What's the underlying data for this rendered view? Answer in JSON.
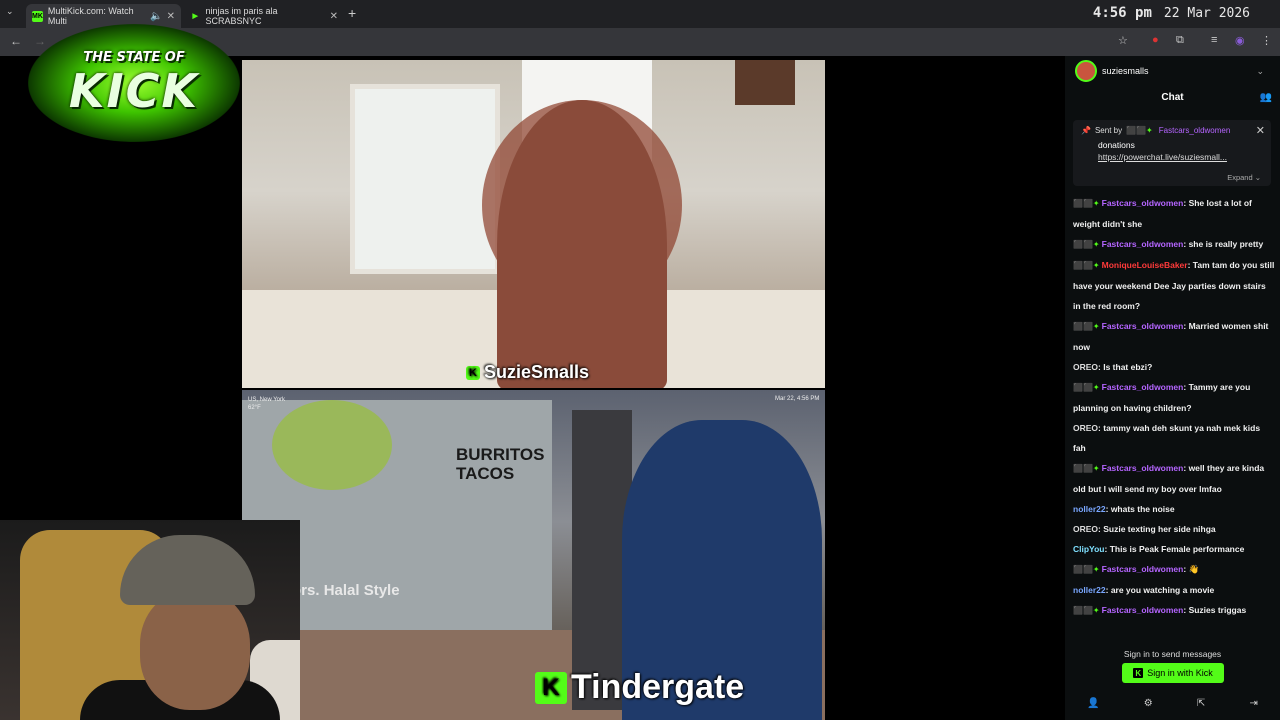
{
  "browser": {
    "tabs": [
      {
        "label": "MultiKick.com: Watch Multi",
        "favicon": "MK",
        "active": true
      },
      {
        "label": "ninjas im paris ala SCRABSNYC",
        "favicon": "play-icon",
        "active": false
      }
    ],
    "clock": {
      "time": "4:56 pm",
      "date": "22 Mar 2026"
    }
  },
  "overlay": {
    "logo_line1": "THE STATE OF",
    "logo_line2": "KICK"
  },
  "streams": {
    "top": {
      "streamer": "SuzieSmalls"
    },
    "bottom": {
      "streamer": "Tindergate",
      "location_line1": "US, New York",
      "location_line2": "62°F",
      "date_stamp": "Mar 22, 4:56 PM",
      "sign_text": "Flavors. Halal Style",
      "storefront_line1": "BURRITOS",
      "storefront_line2": "TACOS"
    }
  },
  "chat": {
    "channel": "suziesmalls",
    "title": "Chat",
    "pinned": {
      "sent_by_label": "Sent by",
      "sender": "Fastcars_oldwomen",
      "message": "donations",
      "link": "https://powerchat.live/suziesmall...",
      "expand_label": "Expand"
    },
    "messages": [
      {
        "user": "Fastcars_oldwomen",
        "color": "#b565ff",
        "badges": true,
        "text": "She lost a lot of weight didn't she"
      },
      {
        "user": "Fastcars_oldwomen",
        "color": "#b565ff",
        "badges": true,
        "text": "she is really pretty"
      },
      {
        "user": "MoniqueLouiseBaker",
        "color": "#ff3a3a",
        "badges": true,
        "text": "Tam tam do you still have your weekend Dee Jay parties down stairs in the red room?"
      },
      {
        "user": "Fastcars_oldwomen",
        "color": "#b565ff",
        "badges": true,
        "text": "Married women shit now"
      },
      {
        "user": "OREO",
        "color": "#dddddd",
        "badges": false,
        "text": "Is that ebzi?"
      },
      {
        "user": "Fastcars_oldwomen",
        "color": "#b565ff",
        "badges": true,
        "text": "Tammy are you planning on having children?"
      },
      {
        "user": "OREO",
        "color": "#dddddd",
        "badges": false,
        "text": "tammy wah deh skunt ya nah mek kids fah"
      },
      {
        "user": "Fastcars_oldwomen",
        "color": "#b565ff",
        "badges": true,
        "text": "well they are kinda old but I will send my boy over lmfao"
      },
      {
        "user": "noller22",
        "color": "#7aa7ff",
        "badges": false,
        "text": "whats the noise"
      },
      {
        "user": "OREO",
        "color": "#dddddd",
        "badges": false,
        "text": "Suzie texting her side nihga"
      },
      {
        "user": "ClipYou",
        "color": "#7fe0ff",
        "badges": false,
        "text": "This is Peak Female performance"
      },
      {
        "user": "Fastcars_oldwomen",
        "color": "#b565ff",
        "badges": true,
        "text": "👋"
      },
      {
        "user": "noller22",
        "color": "#7aa7ff",
        "badges": false,
        "text": "are you watching a movie"
      },
      {
        "user": "Fastcars_oldwomen",
        "color": "#b565ff",
        "badges": true,
        "text": "Suzies triggas"
      }
    ],
    "sign_in_prompt": "Sign in to send messages",
    "sign_in_button": "Sign in with Kick",
    "accent": "#53fc18"
  }
}
